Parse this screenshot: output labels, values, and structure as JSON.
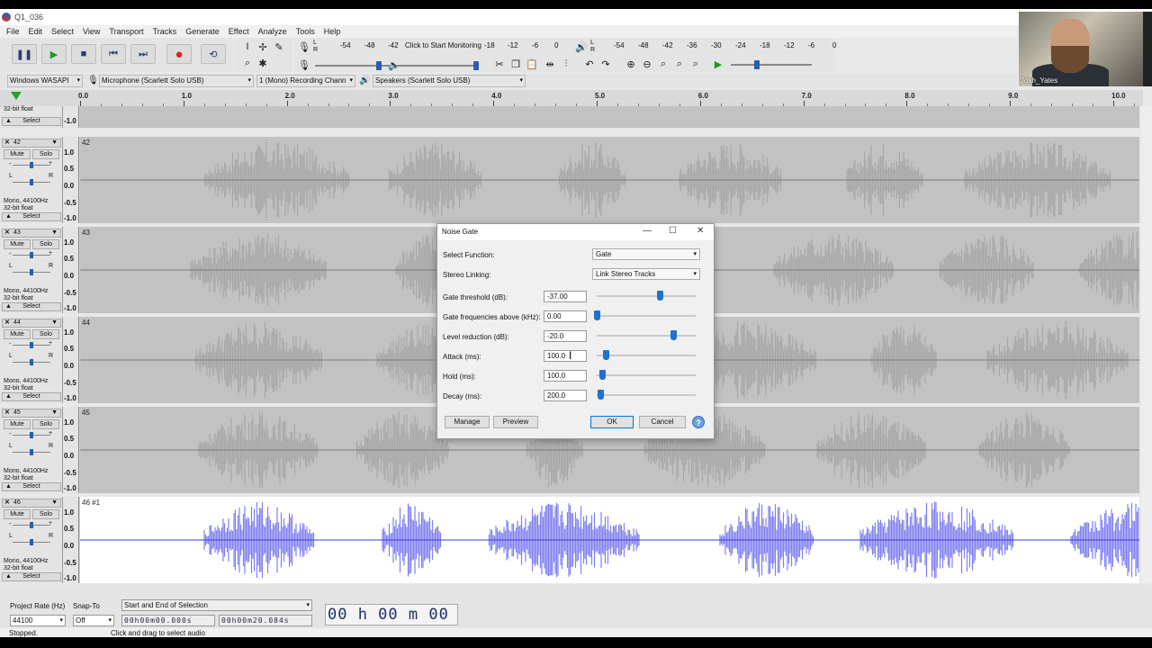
{
  "window": {
    "title": "Q1_036"
  },
  "menu": [
    "File",
    "Edit",
    "Select",
    "View",
    "Transport",
    "Tracks",
    "Generate",
    "Effect",
    "Analyze",
    "Tools",
    "Help"
  ],
  "meter": {
    "record_scale": [
      "-54",
      "-48",
      "-42",
      "-18",
      "-12",
      "-6",
      "0"
    ],
    "monitor_label": "Click to Start Monitoring",
    "play_scale": [
      "-54",
      "-48",
      "-42",
      "-36",
      "-30",
      "-24",
      "-18",
      "-12",
      "-6",
      "0"
    ],
    "record_channels": [
      "L",
      "R"
    ],
    "play_channels": [
      "L",
      "R"
    ]
  },
  "devices": {
    "host": "Windows WASAPI",
    "input": "Microphone (Scarlett Solo USB)",
    "channels": "1 (Mono) Recording Chann",
    "output": "Speakers (Scarlett Solo USB)"
  },
  "timeline": [
    "0.0",
    "1.0",
    "2.0",
    "3.0",
    "4.0",
    "5.0",
    "6.0",
    "7.0",
    "8.0",
    "9.0",
    "10.0"
  ],
  "tracks": [
    {
      "id": "42",
      "label": "42",
      "selected": false
    },
    {
      "id": "43",
      "label": "43",
      "selected": false
    },
    {
      "id": "44",
      "label": "44",
      "selected": false
    },
    {
      "id": "45",
      "label": "45",
      "selected": false
    },
    {
      "id": "46",
      "label": "46 #1",
      "selected": true
    }
  ],
  "track_common": {
    "mute": "Mute",
    "solo": "Solo",
    "select": "Select",
    "info_line1": "Mono, 44100Hz",
    "info_line2": "32-bit float",
    "top_partial_info": "32-bit float",
    "scale": [
      "1.0",
      "0.5",
      "0.0",
      "-0.5",
      "-1.0"
    ],
    "gain_minus": "-",
    "gain_plus": "+",
    "pan_l": "L",
    "pan_r": "R"
  },
  "dialog": {
    "title": "Noise Gate",
    "select_function_label": "Select Function:",
    "select_function_value": "Gate",
    "stereo_linking_label": "Stereo Linking:",
    "stereo_linking_value": "Link Stereo Tracks",
    "params": [
      {
        "label": "Gate threshold (dB):",
        "value": "-37.00",
        "slider": 0.64
      },
      {
        "label": "Gate frequencies above (kHz):",
        "value": "0.00",
        "slider": 0.0
      },
      {
        "label": "Level reduction (dB):",
        "value": "-20.0",
        "slider": 0.77
      },
      {
        "label": "Attack (ms):",
        "value": "100.0",
        "slider": 0.09
      },
      {
        "label": "Hold (ms):",
        "value": "100.0",
        "slider": 0.05
      },
      {
        "label": "Decay (ms):",
        "value": "200.0",
        "slider": 0.04
      }
    ],
    "manage": "Manage",
    "preview": "Preview",
    "ok": "OK",
    "cancel": "Cancel",
    "help": "?"
  },
  "bottom": {
    "project_rate_label": "Project Rate (Hz)",
    "project_rate_value": "44100",
    "snap_label": "Snap-To",
    "snap_value": "Off",
    "selection_mode": "Start and End of Selection",
    "sel_start": "00h00m00.000s",
    "sel_end": "00h00m20.084s",
    "audio_position": "00 h 00 m 00 s"
  },
  "status": {
    "left": "Stopped.",
    "right": "Click and drag to select audio"
  },
  "webcam": {
    "name": "Josh_Yates"
  }
}
